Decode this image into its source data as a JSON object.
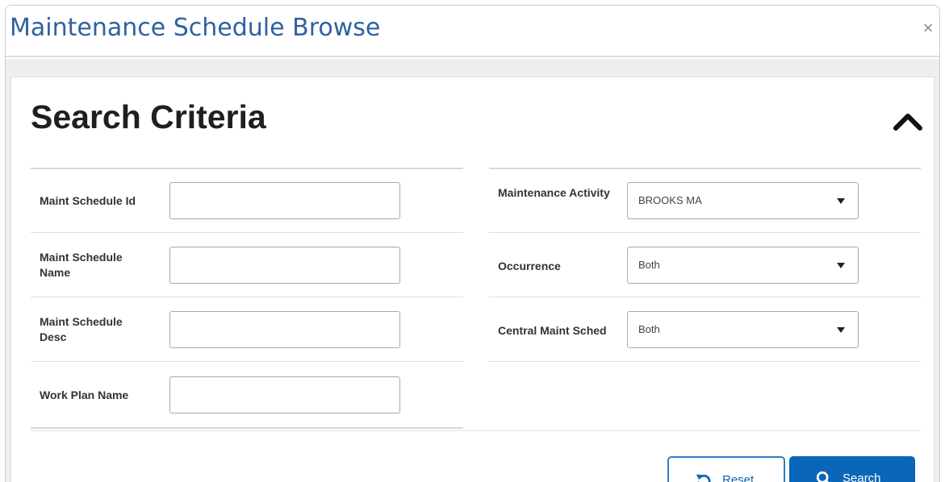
{
  "dialog": {
    "title": "Maintenance Schedule Browse",
    "close_label": "×"
  },
  "search_criteria": {
    "title": "Search Criteria",
    "left_fields": [
      {
        "label": "Maint Schedule Id",
        "value": ""
      },
      {
        "label": "Maint Schedule Name",
        "value": ""
      },
      {
        "label": "Maint Schedule Desc",
        "value": ""
      },
      {
        "label": "Work Plan Name",
        "value": ""
      }
    ],
    "right_fields": [
      {
        "label": "Maintenance Activity",
        "value": "BROOKS MA"
      },
      {
        "label": "Occurrence",
        "value": "Both"
      },
      {
        "label": "Central Maint Sched",
        "value": "Both"
      }
    ]
  },
  "actions": {
    "reset_label": "Reset",
    "search_label": "Search"
  },
  "colors": {
    "title": "#2f62a0",
    "primary": "#0a66b8",
    "reset_border": "#2f7fc4"
  },
  "icons": {
    "close": "close-icon",
    "collapse": "chevron-up-icon",
    "reset": "undo-icon",
    "search": "search-icon",
    "dropdown": "caret-down-icon"
  }
}
